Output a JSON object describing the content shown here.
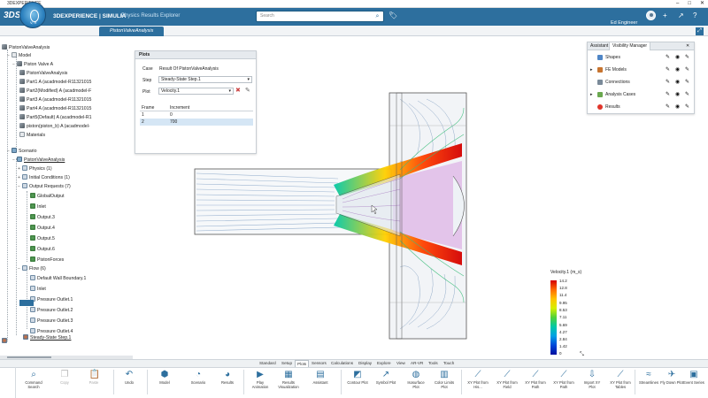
{
  "window": {
    "title": "3DEXPERIENCE"
  },
  "topbar": {
    "compass_label": "V, R",
    "brand": "3DEXPERIENCE | SIMULIA",
    "app_name": "Physics Results Explorer",
    "search_placeholder": "Search",
    "user": "Ed Engineer"
  },
  "doc_tab": "PistonValveAnalysis",
  "tree": {
    "root": "PistonValveAnalysis",
    "model": "Model",
    "model_child": "Piston Valve A",
    "model_items": [
      "PistonValveAnalysis",
      "Part1 A (acadmodel-R11321015",
      "Part2(Modified) A (acadmodel-F",
      "Part3 A (acadmodel-R11321015",
      "Part4 A (acadmodel-R11321015",
      "Part5(Default) A (acadmodel-R1",
      "piston(piston_b) A (acadmodel-",
      "Materials"
    ],
    "scenario": "Scenario",
    "scenario_child": "PistonValveAnalysis",
    "scenario_items": [
      "Physics (1)",
      "Initial Conditions (1)",
      "Output Requests (7)"
    ],
    "outputs": [
      "GlobalOutput",
      "Inlet",
      "Output.3",
      "Output.4",
      "Output.5",
      "Output.6",
      "PistonForces"
    ],
    "flow": "Flow (6)",
    "flow_items": [
      "Default Wall Boundary.1",
      "Inlet",
      "Pressure Outlet.1",
      "Pressure Outlet.2",
      "Pressure Outlet.3",
      "Pressure Outlet.4"
    ],
    "step": "Steady-State Step.1"
  },
  "plots": {
    "title": "Plots",
    "case_label": "Case",
    "case_value": "Result Of PistonValveAnalysis",
    "step_label": "Step",
    "step_value": "Steady-State Step.1",
    "plot_label": "Plot",
    "plot_value": "Velocity.1",
    "frame_col": "Frame",
    "increment_col": "Increment",
    "frames": [
      {
        "frame": "1",
        "increment": "0"
      },
      {
        "frame": "2",
        "increment": "700"
      }
    ]
  },
  "visibility": {
    "tab_assistant": "Assistant",
    "tab_manager": "Visibility Manager",
    "rows": [
      {
        "label": "Shapes",
        "color": "#4f86c6"
      },
      {
        "label": "FE Models",
        "color": "#c7742f"
      },
      {
        "label": "Connections",
        "color": "#7a8a99"
      },
      {
        "label": "Analysis Cases",
        "color": "#6aa84f"
      },
      {
        "label": "Results",
        "color": "#e0352b"
      }
    ]
  },
  "legend": {
    "title": "Velocity.1 (m_s)",
    "ticks": [
      "14.2",
      "12.8",
      "11.4",
      "9.95",
      "8.53",
      "7.11",
      "5.69",
      "4.27",
      "2.84",
      "1.42",
      "0"
    ]
  },
  "command_tabs": [
    "Standard",
    "Setup",
    "Plots",
    "Sensors",
    "Calculations",
    "Display",
    "Explore",
    "View",
    "AR-VR",
    "Tools",
    "Touch"
  ],
  "commands": [
    {
      "label": "Command Search",
      "icon": "⌕"
    },
    {
      "label": "Copy",
      "icon": "❐"
    },
    {
      "label": "Paste",
      "icon": "📋"
    },
    {
      "label": "Undo",
      "icon": "↶"
    },
    {
      "label": "Model",
      "icon": "⬢"
    },
    {
      "label": "Scenario",
      "icon": "◔"
    },
    {
      "label": "Results",
      "icon": "◕"
    },
    {
      "label": "Play Animation",
      "icon": "▶"
    },
    {
      "label": "Results Visualization",
      "icon": "▦"
    },
    {
      "label": "Assistant",
      "icon": "▤"
    },
    {
      "label": "Contour Plot",
      "icon": "◩"
    },
    {
      "label": "Symbol Plot",
      "icon": "↗"
    },
    {
      "label": "Isosurface Plot",
      "icon": "◍"
    },
    {
      "label": "Color Limits Plot",
      "icon": "▥"
    },
    {
      "label": "XY Plot from His...",
      "icon": "⟋"
    },
    {
      "label": "XY Plot from Field",
      "icon": "⟋"
    },
    {
      "label": "XY Plot from Path",
      "icon": "⟋"
    },
    {
      "label": "XY Plot from Path",
      "icon": "⟋"
    },
    {
      "label": "Import XY Plot",
      "icon": "⇩"
    },
    {
      "label": "XY Plot from Tables",
      "icon": "⟋"
    },
    {
      "label": "Streamlines",
      "icon": "≈"
    },
    {
      "label": "Fly Down Plot",
      "icon": "✈"
    },
    {
      "label": "Event Series",
      "icon": "▣"
    }
  ],
  "colors": {
    "brand": "#2d6f9e",
    "tab_active": "#2d6f9e"
  }
}
